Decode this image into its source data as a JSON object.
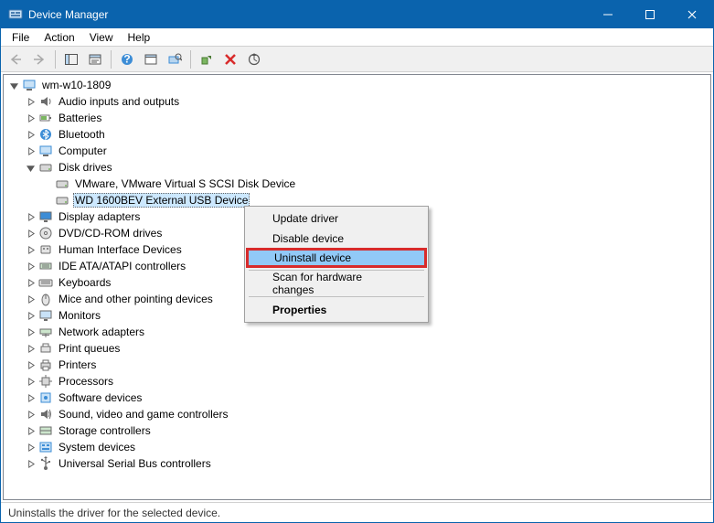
{
  "titlebar": {
    "title": "Device Manager"
  },
  "menubar": {
    "items": [
      "File",
      "Action",
      "View",
      "Help"
    ]
  },
  "tree": {
    "root_label": "wm-w10-1809",
    "categories": [
      {
        "label": "Audio inputs and outputs",
        "icon": "audio",
        "expanded": false
      },
      {
        "label": "Batteries",
        "icon": "battery",
        "expanded": false
      },
      {
        "label": "Bluetooth",
        "icon": "bluetooth",
        "expanded": false
      },
      {
        "label": "Computer",
        "icon": "computer",
        "expanded": false
      },
      {
        "label": "Disk drives",
        "icon": "disk",
        "expanded": true,
        "children": [
          {
            "label": "VMware, VMware Virtual S SCSI Disk Device",
            "icon": "disk"
          },
          {
            "label": "WD 1600BEV External USB Device",
            "icon": "disk",
            "selected": true
          }
        ]
      },
      {
        "label": "Display adapters",
        "icon": "display",
        "expanded": false
      },
      {
        "label": "DVD/CD-ROM drives",
        "icon": "dvd",
        "expanded": false
      },
      {
        "label": "Human Interface Devices",
        "icon": "hid",
        "expanded": false
      },
      {
        "label": "IDE ATA/ATAPI controllers",
        "icon": "ide",
        "expanded": false
      },
      {
        "label": "Keyboards",
        "icon": "keyboard",
        "expanded": false
      },
      {
        "label": "Mice and other pointing devices",
        "icon": "mouse",
        "expanded": false
      },
      {
        "label": "Monitors",
        "icon": "monitor",
        "expanded": false
      },
      {
        "label": "Network adapters",
        "icon": "network",
        "expanded": false
      },
      {
        "label": "Print queues",
        "icon": "printqueue",
        "expanded": false
      },
      {
        "label": "Printers",
        "icon": "printer",
        "expanded": false
      },
      {
        "label": "Processors",
        "icon": "cpu",
        "expanded": false
      },
      {
        "label": "Software devices",
        "icon": "software",
        "expanded": false
      },
      {
        "label": "Sound, video and game controllers",
        "icon": "sound",
        "expanded": false
      },
      {
        "label": "Storage controllers",
        "icon": "storage",
        "expanded": false
      },
      {
        "label": "System devices",
        "icon": "system",
        "expanded": false
      },
      {
        "label": "Universal Serial Bus controllers",
        "icon": "usb",
        "expanded": false
      }
    ]
  },
  "context_menu": {
    "items": [
      {
        "label": "Update driver",
        "type": "item"
      },
      {
        "label": "Disable device",
        "type": "item"
      },
      {
        "label": "Uninstall device",
        "type": "item",
        "highlight": true
      },
      {
        "type": "sep"
      },
      {
        "label": "Scan for hardware changes",
        "type": "item"
      },
      {
        "type": "sep"
      },
      {
        "label": "Properties",
        "type": "item",
        "bold": true
      }
    ]
  },
  "statusbar": {
    "text": "Uninstalls the driver for the selected device."
  }
}
